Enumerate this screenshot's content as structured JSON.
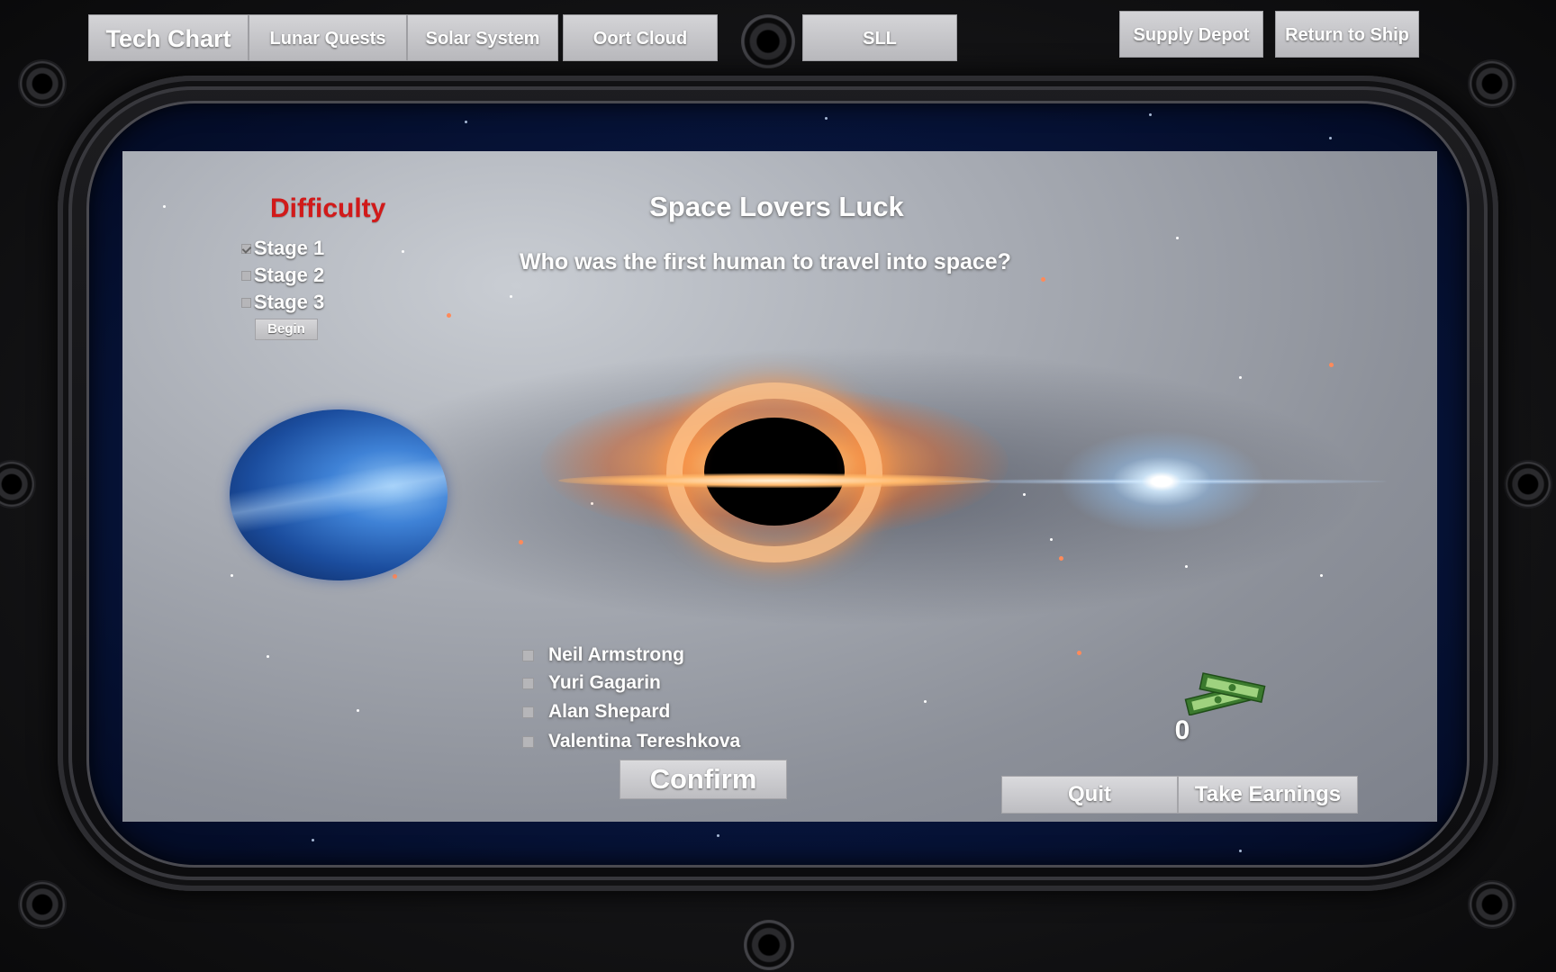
{
  "nav": {
    "tech_chart": "Tech Chart",
    "lunar_quests": "Lunar Quests",
    "solar_system": "Solar System",
    "oort_cloud": "Oort Cloud",
    "sll": "SLL",
    "supply_depot": "Supply Depot",
    "return_to_ship": "Return to Ship"
  },
  "difficulty": {
    "title": "Difficulty",
    "stages": [
      {
        "label": "Stage 1",
        "checked": true
      },
      {
        "label": "Stage 2",
        "checked": false
      },
      {
        "label": "Stage 3",
        "checked": false
      }
    ],
    "begin_label": "Begin"
  },
  "game": {
    "title": "Space Lovers Luck",
    "question": "Who was the first human to travel into space?",
    "answers": [
      {
        "label": "Neil Armstrong"
      },
      {
        "label": "Yuri Gagarin"
      },
      {
        "label": "Alan Shepard"
      },
      {
        "label": "Valentina Tereshkova"
      }
    ],
    "confirm_label": "Confirm",
    "quit_label": "Quit",
    "take_earnings_label": "Take Earnings",
    "earnings": "0",
    "money_icon": "cash-stack-icon"
  },
  "colors": {
    "difficulty_title": "#d11a1a",
    "button": "#c8c8cb",
    "text": "#ffffff"
  }
}
